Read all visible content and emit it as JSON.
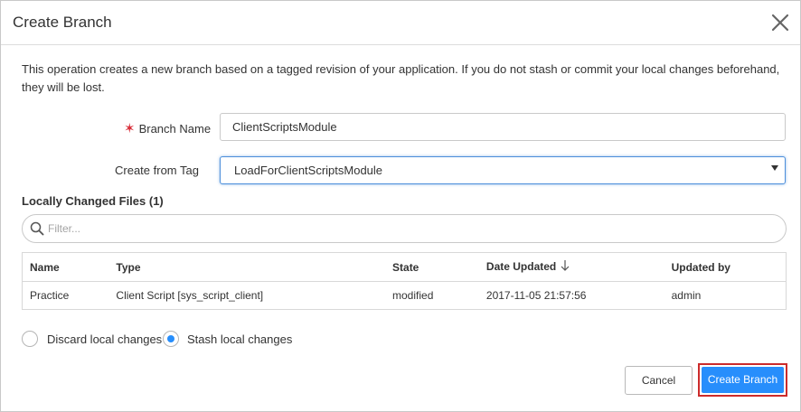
{
  "dialog": {
    "title": "Create Branch",
    "description": "This operation creates a new branch based on a tagged revision of your application. If you do not stash or commit your local changes beforehand, they will be lost."
  },
  "form": {
    "branch_name_label": "Branch Name",
    "branch_name_value": "ClientScriptsModule",
    "create_from_tag_label": "Create from Tag",
    "create_from_tag_value": "LoadForClientScriptsModule"
  },
  "files": {
    "title": "Locally Changed Files (1)",
    "filter_placeholder": "Filter...",
    "columns": [
      "Name",
      "Type",
      "State",
      "Date Updated",
      "Updated by"
    ],
    "rows": [
      [
        "Practice",
        "Client Script [sys_script_client]",
        "modified",
        "2017-11-05 21:57:56",
        "admin"
      ]
    ]
  },
  "options": {
    "discard_label": "Discard local changes",
    "stash_label": "Stash local changes",
    "selected": "stash"
  },
  "buttons": {
    "cancel": "Cancel",
    "create": "Create Branch"
  },
  "colors": {
    "primary": "#278efc",
    "required": "#d9303b",
    "highlight": "#cc2b2b"
  }
}
